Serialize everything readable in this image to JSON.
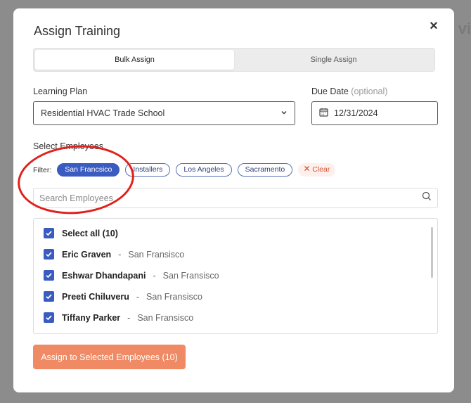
{
  "background": {
    "title_fragment": "vi"
  },
  "modal": {
    "title": "Assign Training",
    "close_glyph": "×"
  },
  "tabs": [
    {
      "label": "Bulk Assign",
      "active": true
    },
    {
      "label": "Single Assign",
      "active": false
    }
  ],
  "learning_plan": {
    "label": "Learning Plan",
    "value": "Residential HVAC Trade School"
  },
  "due_date": {
    "label": "Due Date",
    "label_suffix": "(optional)",
    "value": "12/31/2024"
  },
  "employees": {
    "section_label": "Select Employees",
    "filter_label": "Filter:",
    "filters": [
      {
        "label": "San Francsico",
        "active": true
      },
      {
        "label": "Installers",
        "active": false
      },
      {
        "label": "Los Angeles",
        "active": false
      },
      {
        "label": "Sacramento",
        "active": false
      }
    ],
    "clear_label": "Clear",
    "search_placeholder": "Search Employees",
    "select_all_label": "Select all (10)",
    "list": [
      {
        "name": "Eric Graven",
        "location": "San Fransisco",
        "checked": true
      },
      {
        "name": "Eshwar Dhandapani",
        "location": "San Fransisco",
        "checked": true
      },
      {
        "name": "Preeti Chiluveru",
        "location": "San Fransisco",
        "checked": true
      },
      {
        "name": "Tiffany Parker",
        "location": "San Fransisco",
        "checked": true
      }
    ],
    "separator": "-"
  },
  "assign_button": {
    "label": "Assign to Selected Employees (10)"
  },
  "colors": {
    "accent": "#3a5bbf",
    "button": "#ef8a64",
    "clear": "#d0553c",
    "annotation": "#e0211b"
  },
  "icons": {
    "close": "close-icon",
    "dropdown": "chevron-down-icon",
    "calendar": "calendar-icon",
    "search": "search-icon",
    "check": "check-icon",
    "clear": "x-icon"
  }
}
